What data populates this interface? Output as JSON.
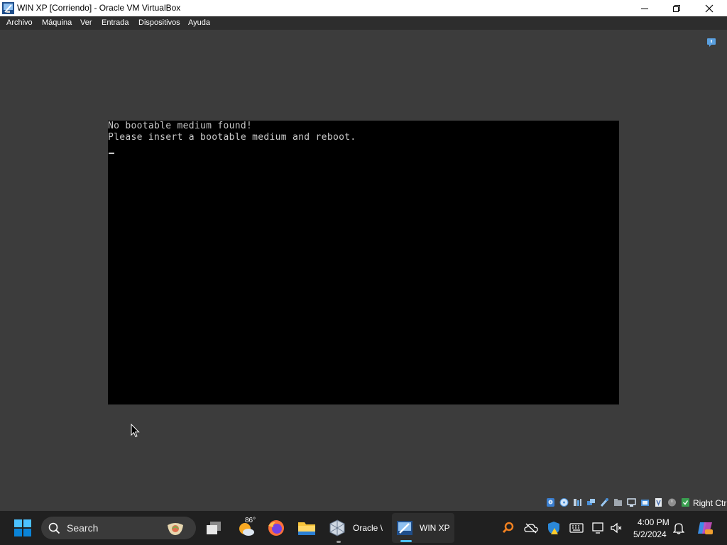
{
  "window": {
    "title": "WIN XP [Corriendo] - Oracle VM VirtualBox",
    "controls": [
      "minimize",
      "maximize",
      "close"
    ]
  },
  "menu": {
    "items": [
      "Archivo",
      "Máquina",
      "Ver",
      "Entrada",
      "Dispositivos",
      "Ayuda"
    ]
  },
  "vm_screen": {
    "lines": [
      "No bootable medium found!",
      "Please insert a bootable medium and reboot."
    ],
    "cursor": "_"
  },
  "status_bar": {
    "icons": [
      "hard-disk-icon",
      "optical-drive-icon",
      "audio-icon",
      "network-icon",
      "usb-icon",
      "shared-folders-icon",
      "display-icon",
      "video-capture-icon",
      "virtualization-icon",
      "mouse-integration-icon",
      "keyboard-capture-icon"
    ],
    "host_key": "Right Ctrl"
  },
  "taskbar": {
    "search_placeholder": "Search",
    "weather_temp": "86°",
    "apps": [
      {
        "name": "start",
        "label": ""
      },
      {
        "name": "task-view",
        "label": ""
      },
      {
        "name": "weather",
        "label": ""
      },
      {
        "name": "firefox",
        "label": ""
      },
      {
        "name": "file-explorer",
        "label": ""
      },
      {
        "name": "oracle-virtualbox",
        "label": "Oracle \\"
      },
      {
        "name": "win-xp",
        "label": "WIN XP"
      }
    ],
    "tray": {
      "time": "4:00 PM",
      "date": "5/2/2024"
    }
  },
  "colors": {
    "desktop": "#3c3c3c",
    "taskbar": "#202020",
    "menubar": "#2d2d2d",
    "accent": "#0078d4"
  }
}
